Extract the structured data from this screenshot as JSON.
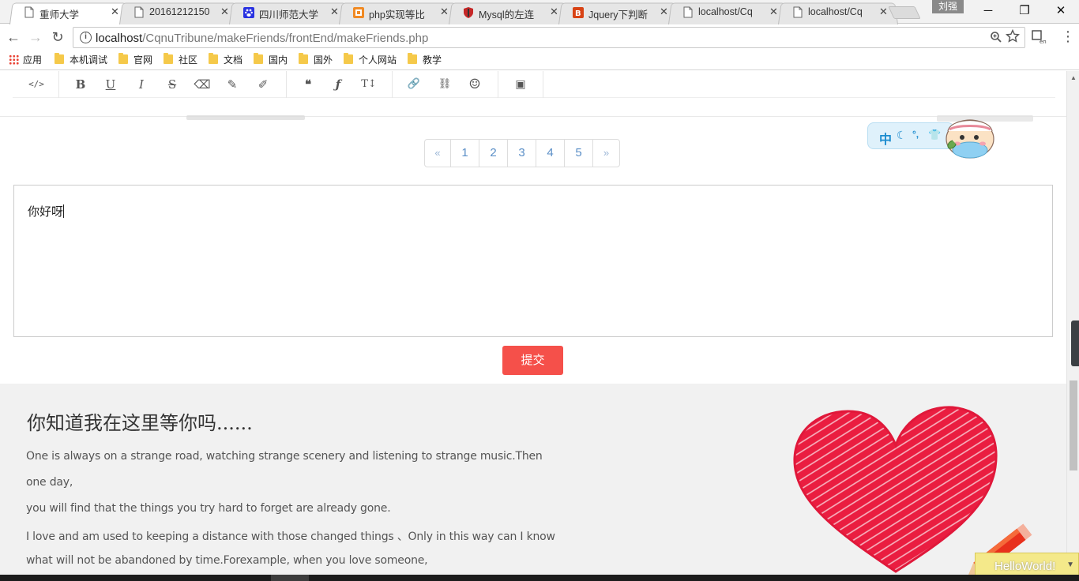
{
  "tabs": [
    {
      "title": "重师大学",
      "icon": "doc",
      "active": true
    },
    {
      "title": "20161212150",
      "icon": "doc",
      "active": false
    },
    {
      "title": "四川师范大学",
      "icon": "paw",
      "active": false
    },
    {
      "title": "php实现等比",
      "icon": "orange",
      "active": false
    },
    {
      "title": "Mysql的左连",
      "icon": "shield",
      "active": false
    },
    {
      "title": "Jquery下判断",
      "icon": "jb",
      "active": false
    },
    {
      "title": "localhost/Cq",
      "icon": "doc",
      "active": false
    },
    {
      "title": "localhost/Cq",
      "icon": "doc",
      "active": false
    }
  ],
  "tab_close_symbol": "✕",
  "profile_name": "刘强",
  "window_controls": {
    "minimize": "─",
    "maximize": "❐",
    "close": "✕"
  },
  "nav": {
    "back": "←",
    "forward": "→",
    "reload": "↻",
    "info": "i"
  },
  "url": {
    "host": "localhost",
    "path": "/CqnuTribune/makeFriends/frontEnd/makeFriends.php"
  },
  "bookmarks": [
    "应用",
    "本机调试",
    "官网",
    "社区",
    "文档",
    "国内",
    "国外",
    "个人网站",
    "教学"
  ],
  "toolbar": {
    "buttons": [
      "</>",
      "B",
      "U",
      "I",
      "S",
      "⌫",
      "✎",
      "✐",
      "❝",
      "ƒ",
      "T↕",
      "🔗",
      "⛓",
      "☺",
      "▣"
    ]
  },
  "pagination": {
    "prev": "«",
    "pages": [
      "1",
      "2",
      "3",
      "4",
      "5"
    ],
    "next": "»"
  },
  "ime": {
    "lang": "中",
    "moon": "☾",
    "dots": "°,",
    "shirt": "👕"
  },
  "editor": {
    "text": "你好呀"
  },
  "submit_label": "提交",
  "footer": {
    "title": "你知道我在这里等你吗......",
    "lines": [
      "One is always on a strange road, watching strange scenery and listening to strange music.Then",
      "one day,",
      "you will find that the things you try hard to forget are already gone.",
      "I love and am used to keeping a distance with those changed things 、Only in this way can I know",
      "what will not be abandoned by time.Forexample, when you love someone,"
    ]
  },
  "hello_widget": {
    "label": "HelloWorld!",
    "arrow": "▼"
  },
  "colors": {
    "accent": "#f5504a",
    "link": "#5b8fc7",
    "footer_bg": "#f1f1f1",
    "heart": "#e8193c"
  }
}
